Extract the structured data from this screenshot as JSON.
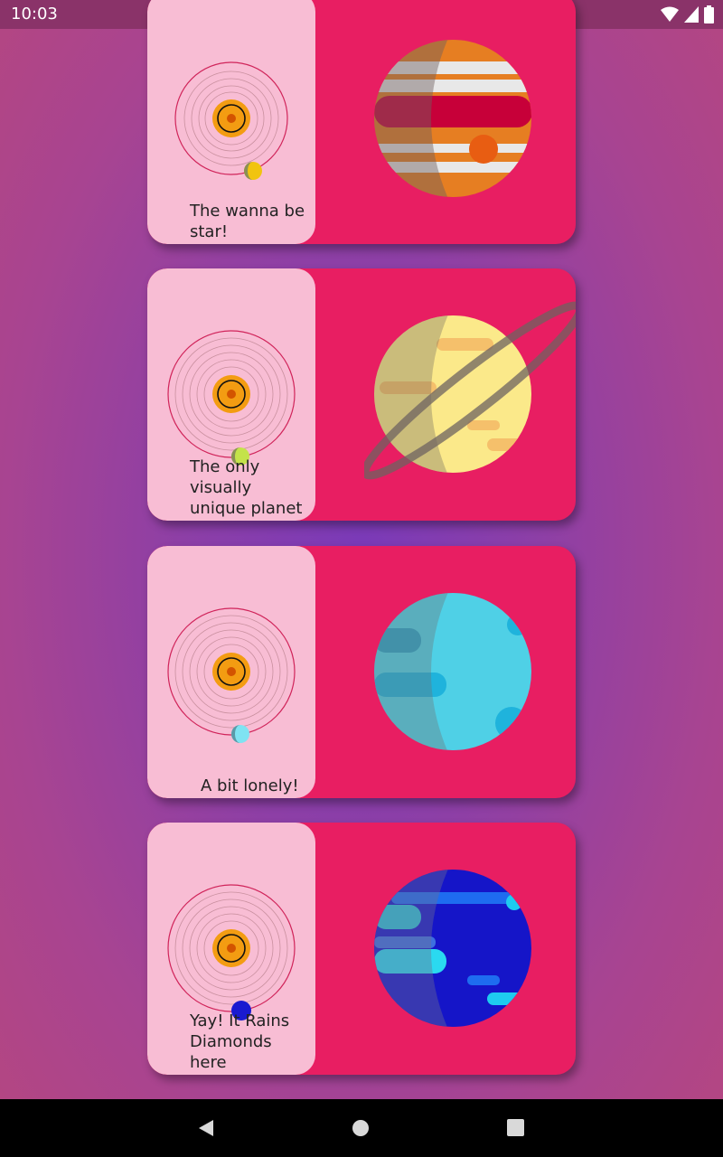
{
  "status_bar": {
    "time": "10:03",
    "icons": [
      "wifi-icon",
      "cell-signal-icon",
      "battery-icon"
    ]
  },
  "cards": [
    {
      "caption": "The wanna be\nstar!",
      "planet": "jupiter-icon"
    },
    {
      "caption": "The only\nvisually\nunique planet",
      "planet": "saturn-icon"
    },
    {
      "caption": "A bit lonely!",
      "planet": "uranus-icon"
    },
    {
      "caption": "Yay! It Rains\nDiamonds\nhere",
      "planet": "neptune-icon"
    }
  ],
  "nav_bar": {
    "buttons": [
      "back-icon",
      "home-icon",
      "recents-icon"
    ]
  },
  "colors": {
    "card_bg": "#e81e62",
    "card_left_bg": "#f8bdd4",
    "status_bar": "#8a3369"
  }
}
